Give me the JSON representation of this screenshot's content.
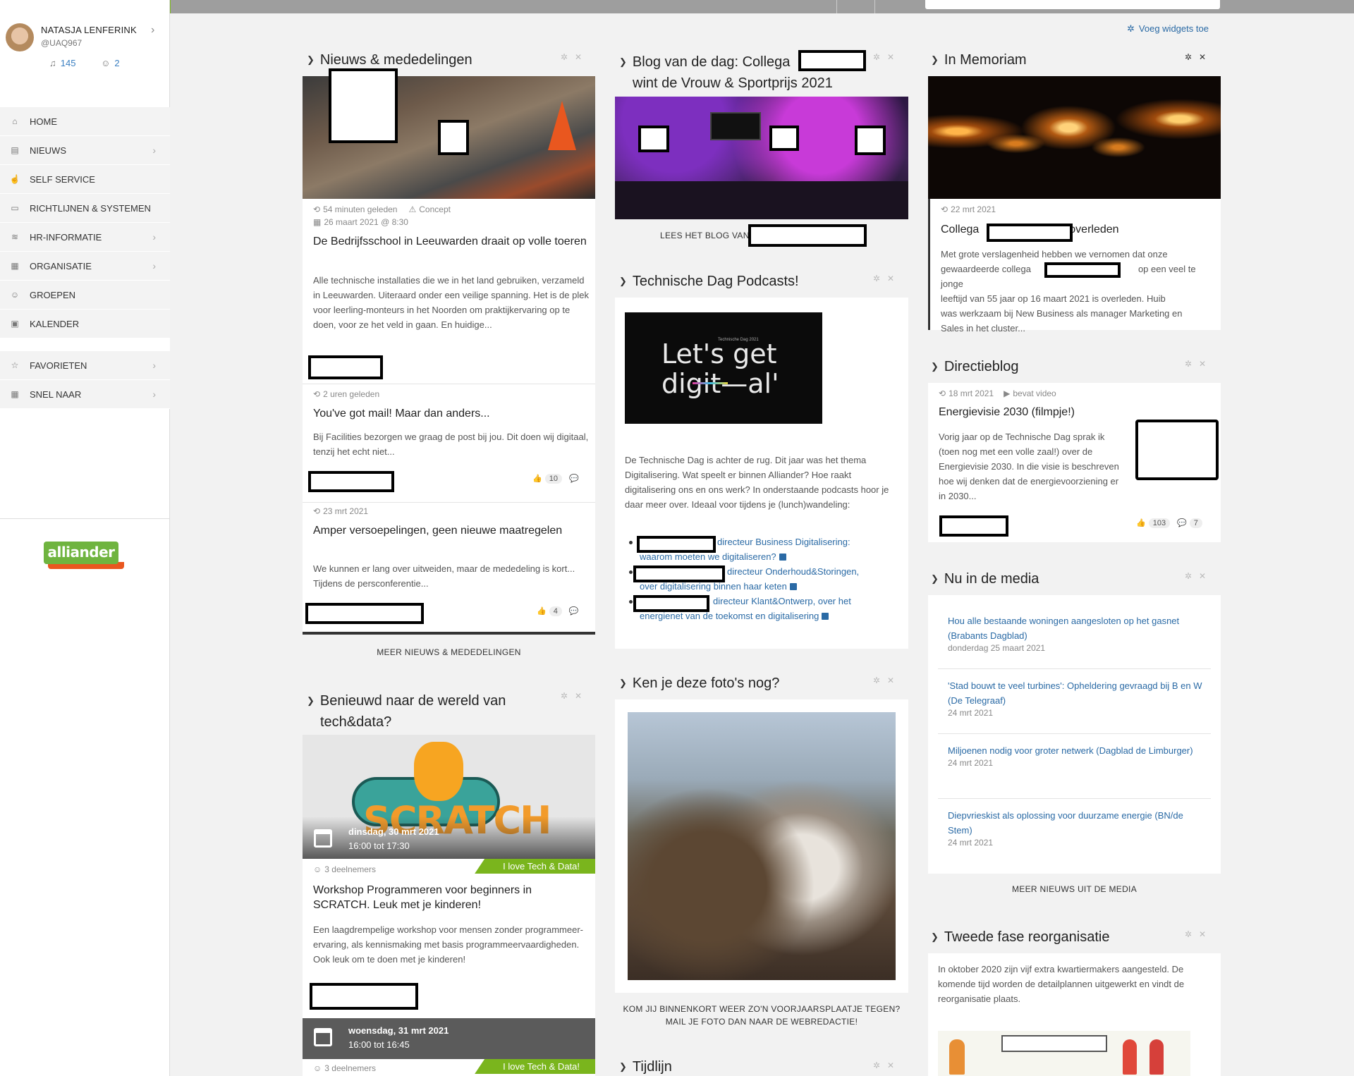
{
  "profile": {
    "name": "NATASJA LENFERINK",
    "handle": "@UAQ967",
    "notifications": "145",
    "groups": "2"
  },
  "nav": [
    {
      "label": "HOME",
      "icon": "home-icon",
      "glyph": "⌂",
      "chevron": false
    },
    {
      "label": "NIEUWS",
      "icon": "news-icon",
      "glyph": "▤",
      "chevron": true
    },
    {
      "label": "SELF SERVICE",
      "icon": "hand-icon",
      "glyph": "☝",
      "chevron": false
    },
    {
      "label": "RICHTLIJNEN & SYSTEMEN",
      "icon": "monitor-icon",
      "glyph": "▭",
      "chevron": false
    },
    {
      "label": "HR-INFORMATIE",
      "icon": "hr-icon",
      "glyph": "≋",
      "chevron": true
    },
    {
      "label": "ORGANISATIE",
      "icon": "building-icon",
      "glyph": "▦",
      "chevron": true
    },
    {
      "label": "GROEPEN",
      "icon": "groups-icon",
      "glyph": "☺",
      "chevron": false
    },
    {
      "label": "KALENDER",
      "icon": "calendar-icon",
      "glyph": "▣",
      "chevron": false
    },
    {
      "label": "FAVORIETEN",
      "icon": "star-icon",
      "glyph": "☆",
      "chevron": true
    },
    {
      "label": "SNEL NAAR",
      "icon": "grid-icon",
      "glyph": "▦",
      "chevron": true
    }
  ],
  "logo_text": "alliander",
  "add_widgets": "Voeg widgets toe",
  "news": {
    "title": "Nieuws & mededelingen",
    "items": [
      {
        "meta1": "54 minuten geleden",
        "badge": "Concept",
        "meta2": "26 maart 2021 @ 8:30",
        "title": "De Bedrijfsschool in Leeuwarden draait op volle toeren",
        "body": "Alle technische installaties die we in het land gebruiken, verzameld in Leeuwarden. Uiteraard onder een veilige spanning. Het is de plek voor leerling-monteurs in het Noorden om praktijkervaring op te doen, voor ze het veld in gaan. En huidige..."
      },
      {
        "meta1": "2 uren geleden",
        "title": "You've got mail! Maar dan anders...",
        "body": "Bij Facilities bezorgen we graag de post bij jou. Dit doen wij digitaal, tenzij het echt niet...",
        "likes": "10"
      },
      {
        "meta1": "23 mrt 2021",
        "title": "Amper versoepelingen, geen nieuwe maatregelen",
        "body": "We kunnen er lang over uitweiden, maar de mededeling is kort... Tijdens de persconferentie...",
        "likes": "4"
      }
    ],
    "more": "MEER NIEUWS & MEDEDELINGEN"
  },
  "tech": {
    "title_l1": "Benieuwd naar de wereld van",
    "title_l2": "tech&data?",
    "events": [
      {
        "date": "dinsdag, 30 mrt 2021",
        "time": "16:00 tot 17:30",
        "participants": "3 deelnemers",
        "tag": "I love Tech & Data!",
        "title": "Workshop Programmeren voor beginners in SCRATCH. Leuk met je kinderen!",
        "body": "Een laagdrempelige workshop voor mensen zonder programmeer-ervaring, als kennismaking met basis programmeervaardigheden. Ook leuk om te doen met je kinderen!"
      },
      {
        "date": "woensdag, 31 mrt 2021",
        "time": "16:00 tot 16:45",
        "participants": "3 deelnemers",
        "tag": "I love Tech & Data!"
      }
    ]
  },
  "blog": {
    "title_l1": "Blog van de dag: Collega",
    "title_l2": "wint de Vrouw & Sportprijs 2021",
    "link": "LEES HET BLOG VAN"
  },
  "podcasts": {
    "title": "Technische Dag Podcasts!",
    "image_small": "Technische Dag 2021",
    "image_l1": "Let's get",
    "image_l2": "digit—al'",
    "body": "De Technische Dag is achter de rug. Dit jaar was het thema Digitalisering. Wat speelt er binnen Alliander? Hoe raakt digitalisering ons en ons werk? In onderstaande podcasts hoor je daar meer over. Ideaal voor tijdens je (lunch)wandeling:",
    "links": [
      {
        "l1": "directeur Business Digitalisering:",
        "l2": "waarom moeten we digitaliseren?"
      },
      {
        "l1": "directeur Onderhoud&Storingen,",
        "l2": "over digitalisering binnen haar keten"
      },
      {
        "l1": "directeur Klant&Ontwerp, over het",
        "l2": "energienet van de toekomst en digitalisering"
      }
    ]
  },
  "photos": {
    "title": "Ken je deze foto's nog?",
    "caption_l1": "KOM JIJ BINNENKORT WEER ZO'N VOORJAARSPLAATJE TEGEN?",
    "caption_l2": "MAIL JE FOTO DAN NAAR DE WEBREDACTIE!"
  },
  "timeline": {
    "title": "Tijdlijn"
  },
  "memoriam": {
    "title": "In Memoriam",
    "date": "22 mrt 2021",
    "title_a": "Collega",
    "title_b": "overleden",
    "body_l1": "Met grote verslagenheid hebben we vernomen dat onze",
    "body_l2a": "gewaardeerde collega",
    "body_l2b": "op een veel te jonge",
    "body_l3a": "leeftijd van 55 jaar op",
    "body_l3b": "16 maart 2021 is overleden. Huib",
    "body_l4": "was werkzaam bij New Business als manager Marketing en",
    "body_l5": "Sales in het cluster..."
  },
  "directieblog": {
    "title": "Directieblog",
    "date": "18 mrt 2021",
    "badge": "bevat video",
    "post_title": "Energievisie 2030 (filmpje!)",
    "body": "Vorig jaar op de Technische Dag sprak ik (toen nog met een volle zaal!) over de Energievisie 2030. In die visie is beschreven hoe wij denken dat de energievoorziening er in 2030...",
    "likes": "103",
    "comments": "7"
  },
  "media": {
    "title": "Nu in de media",
    "items": [
      {
        "title": "Hou alle bestaande woningen aangesloten op het gasnet (Brabants Dagblad)",
        "date": "donderdag 25 maart 2021"
      },
      {
        "title": "'Stad bouwt te veel turbines': Opheldering gevraagd bij B en W (De Telegraaf)",
        "date": "24 mrt 2021"
      },
      {
        "title": "Miljoenen nodig voor groter netwerk (Dagblad de Limburger)",
        "date": "24 mrt 2021"
      },
      {
        "title": "Diepvrieskist als oplossing voor duurzame energie (BN/de Stem)",
        "date": "24 mrt 2021"
      }
    ],
    "more": "MEER NIEUWS UIT DE MEDIA"
  },
  "reorg": {
    "title": "Tweede fase reorganisatie",
    "body": "In oktober 2020 zijn vijf extra kwartiermakers aangesteld. De komende tijd worden de detailplannen uitgewerkt en vindt de reorganisatie plaats."
  }
}
